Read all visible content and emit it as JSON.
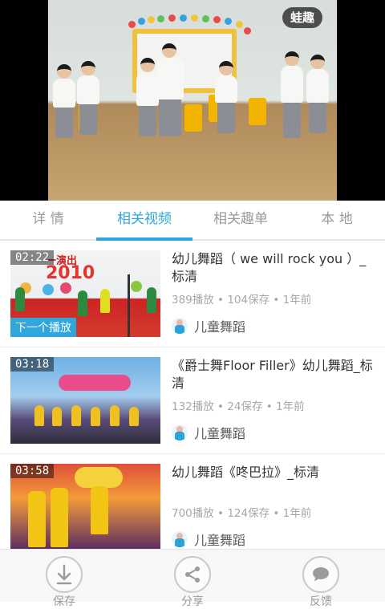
{
  "player": {
    "watermark": "蛙趣"
  },
  "tabs": [
    {
      "label": "详 情",
      "active": false
    },
    {
      "label": "相关视频",
      "active": true
    },
    {
      "label": "相关趣单",
      "active": false
    },
    {
      "label": "本 地",
      "active": false
    }
  ],
  "videos": [
    {
      "duration": "02:22",
      "title": "幼儿舞蹈（ we will rock you ）_标清",
      "stats": "389播放 • 104保存 • 1年前",
      "channel": "儿童舞蹈",
      "badge": "下一个播放",
      "thumb_banner": "一演出",
      "thumb_year": "2010"
    },
    {
      "duration": "03:18",
      "title": "《爵士舞Floor Filler》幼儿舞蹈_标清",
      "stats": "132播放 • 24保存 • 1年前",
      "channel": "儿童舞蹈"
    },
    {
      "duration": "03:58",
      "title": "幼儿舞蹈《咚巴拉》_标清",
      "stats": "700播放 • 124保存 • 1年前",
      "channel": "儿童舞蹈"
    }
  ],
  "actions": [
    {
      "label": "保存",
      "icon": "download-icon"
    },
    {
      "label": "分享",
      "icon": "share-icon"
    },
    {
      "label": "反馈",
      "icon": "feedback-icon"
    }
  ],
  "colors": {
    "accent": "#2fa6dc",
    "tab_inactive": "#9a9a9a",
    "meta_text": "#a7a7a7"
  }
}
